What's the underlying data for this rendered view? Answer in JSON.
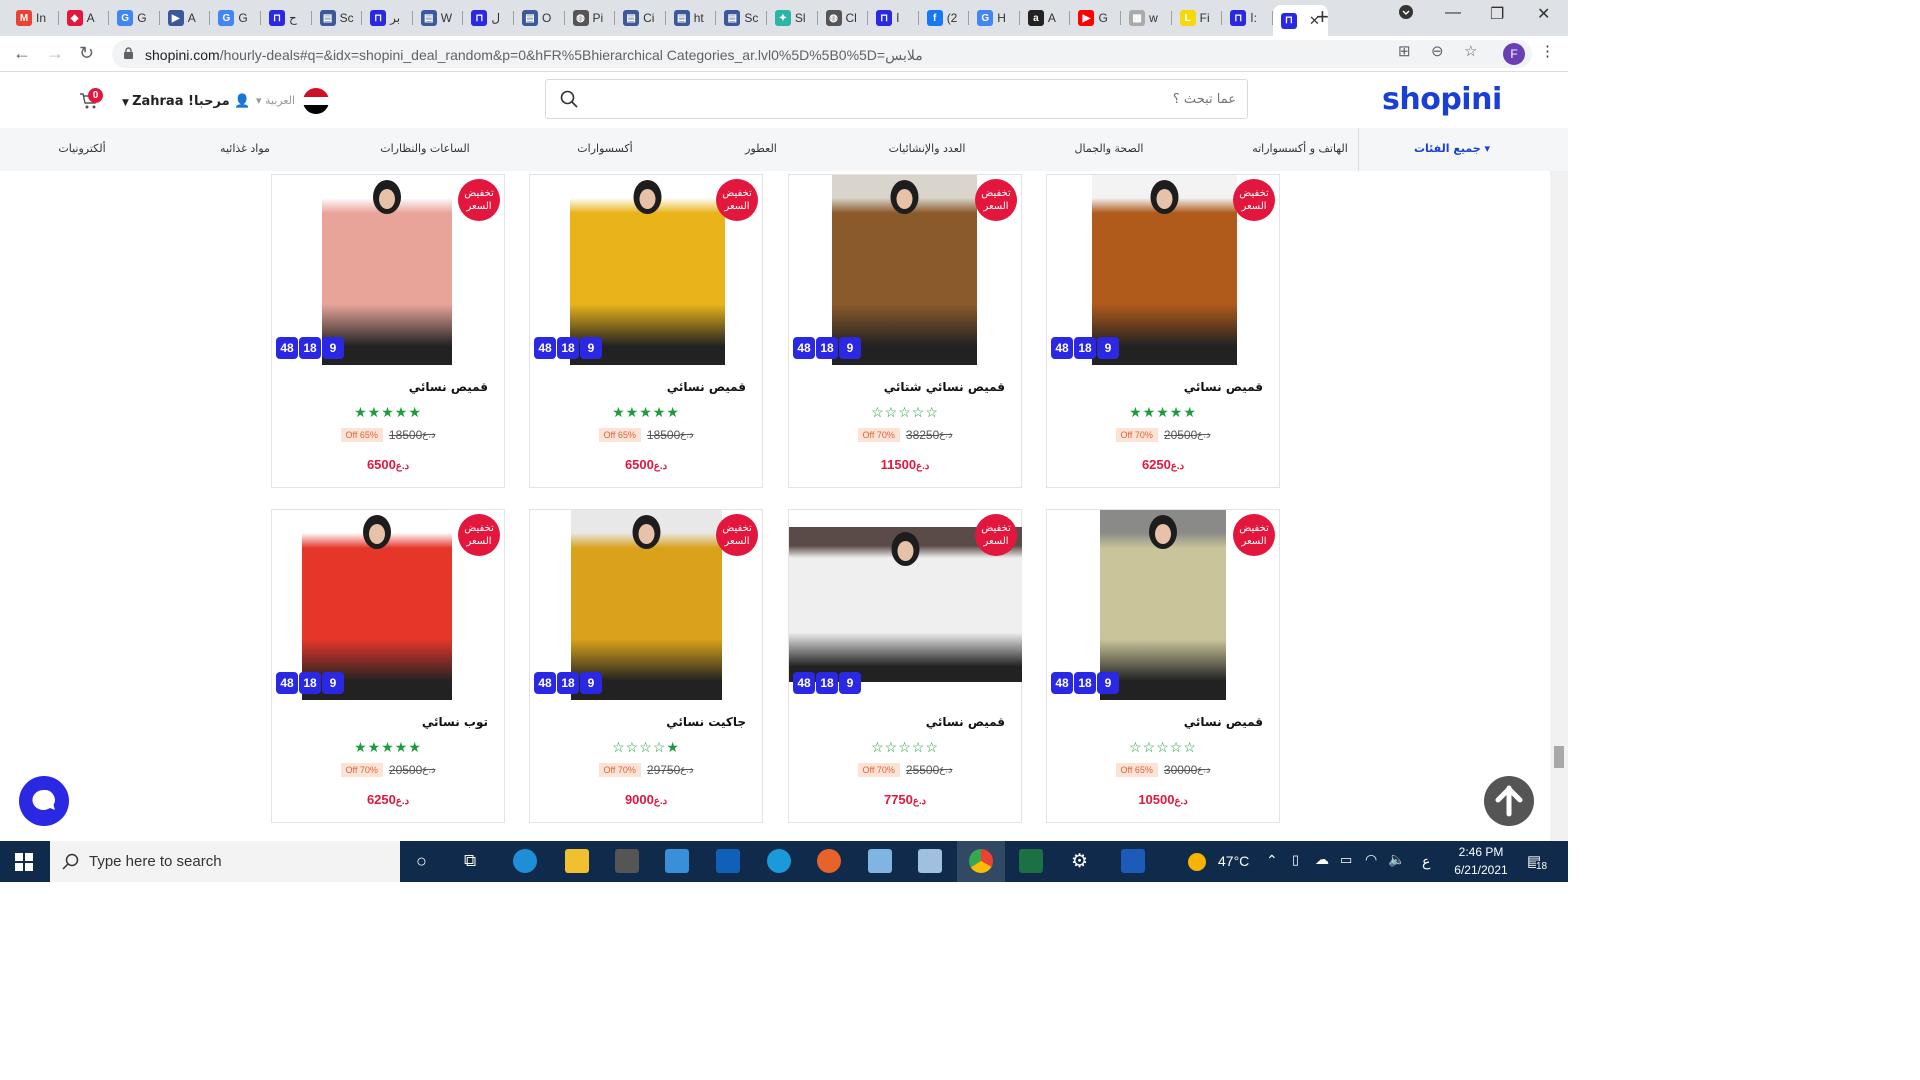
{
  "browser": {
    "tabs": [
      {
        "label": "In",
        "icon": "gmail-icon",
        "color": "#ea4335",
        "glyph": "M"
      },
      {
        "label": "A",
        "icon": "app-icon",
        "color": "#e3173e",
        "glyph": "◆"
      },
      {
        "label": "G",
        "icon": "google-translate-icon",
        "color": "#4285f4",
        "glyph": "G"
      },
      {
        "label": "A",
        "icon": "send-icon",
        "color": "#3b5998",
        "glyph": "▶"
      },
      {
        "label": "G",
        "icon": "google-translate-icon",
        "color": "#4285f4",
        "glyph": "G"
      },
      {
        "label": "ح",
        "icon": "shopini-icon",
        "color": "#2b28e3",
        "glyph": "⊓"
      },
      {
        "label": "Sc",
        "icon": "doc-icon",
        "color": "#3c5a99",
        "glyph": "▤"
      },
      {
        "label": "بر",
        "icon": "shopini-icon",
        "color": "#2b28e3",
        "glyph": "⊓"
      },
      {
        "label": "W",
        "icon": "doc-icon",
        "color": "#3c5a99",
        "glyph": "▤"
      },
      {
        "label": "ل",
        "icon": "shopini-icon",
        "color": "#2b28e3",
        "glyph": "⊓"
      },
      {
        "label": "O",
        "icon": "doc-icon",
        "color": "#3c5a99",
        "glyph": "▤"
      },
      {
        "label": "Pi",
        "icon": "globe-icon",
        "color": "#555555",
        "glyph": "◍"
      },
      {
        "label": "Ci",
        "icon": "doc-icon",
        "color": "#3c5a99",
        "glyph": "▤"
      },
      {
        "label": "ht",
        "icon": "doc-icon",
        "color": "#3c5a99",
        "glyph": "▤"
      },
      {
        "label": "Sc",
        "icon": "doc-icon",
        "color": "#3c5a99",
        "glyph": "▤"
      },
      {
        "label": "Sl",
        "icon": "kite-icon",
        "color": "#2bb5a6",
        "glyph": "✦"
      },
      {
        "label": "Cl",
        "icon": "globe-icon",
        "color": "#555555",
        "glyph": "◍"
      },
      {
        "label": "ا",
        "icon": "shopini-icon",
        "color": "#2b28e3",
        "glyph": "⊓"
      },
      {
        "label": "(2",
        "icon": "facebook-icon",
        "color": "#1877f2",
        "glyph": "f"
      },
      {
        "label": "H",
        "icon": "google-icon",
        "color": "#4285f4",
        "glyph": "G"
      },
      {
        "label": "A",
        "icon": "amazon-icon",
        "color": "#222222",
        "glyph": "a"
      },
      {
        "label": "G",
        "icon": "youtube-icon",
        "color": "#ff0000",
        "glyph": "▶"
      },
      {
        "label": "w",
        "icon": "image-icon",
        "color": "#aaaaaa",
        "glyph": "▦"
      },
      {
        "label": "Fi",
        "icon": "l-icon",
        "color": "#f5d90a",
        "glyph": "L"
      },
      {
        "label": "ا:",
        "icon": "shopini-icon",
        "color": "#2b28e3",
        "glyph": "⊓"
      },
      {
        "label": "",
        "icon": "shopini-icon",
        "color": "#2b28e3",
        "glyph": "⊓",
        "active": true
      }
    ],
    "close_glyph": "✕",
    "new_tab_glyph": "+",
    "url_host": "shopini.com",
    "url_rest": "/hourly-deals#q=&idx=shopini_deal_random&p=0&hFR%5Bhierarchical Categories_ar.lvl0%5D%5B0%5D=ملابس",
    "profile_initial": "F"
  },
  "header": {
    "logo": "shopini",
    "search_placeholder": "عما تبحث ؟",
    "language": "العربية",
    "user_greeting": "Zahraa !مرحبا",
    "cart_count": "0"
  },
  "nav": {
    "all_categories": "جميع الفئات ▾",
    "categories": [
      {
        "label": "الهاتف و أكسسواراته"
      },
      {
        "label": "الصحة والجمال"
      },
      {
        "label": "العدد والإنشائيات"
      },
      {
        "label": "العطور"
      },
      {
        "label": "أكسسوارات"
      },
      {
        "label": "الساعات والنظارات"
      },
      {
        "label": "مواد غذائيه"
      },
      {
        "label": "ألكترونيات"
      }
    ]
  },
  "sale_badge": "تخفيض السعر",
  "timer": [
    "48",
    "18",
    "9"
  ],
  "currency_old": "د.ع",
  "currency_new": "د.ع",
  "products": [
    {
      "name": "قميص نسائي",
      "rating": 5,
      "discount": "Off 70%",
      "old_price": "20500",
      "price": "6250",
      "bg": "#b05a1c",
      "bg2": "#f3f3f3"
    },
    {
      "name": "قميص نسائي شتائي",
      "rating": 0,
      "discount": "Off 70%",
      "old_price": "38250",
      "price": "11500",
      "bg": "#8a5a2a",
      "bg2": "#d9d4cc"
    },
    {
      "name": "قميص نسائي",
      "rating": 5,
      "discount": "Off 65%",
      "old_price": "18500",
      "price": "6500",
      "bg": "#e8b41a",
      "bg2": "#ffffff"
    },
    {
      "name": "قميص نسائي",
      "rating": 5,
      "discount": "Off 65%",
      "old_price": "18500",
      "price": "6500",
      "bg": "#e9a49a",
      "bg2": "#ffffff"
    },
    {
      "name": "قميص نسائي",
      "rating": 0,
      "discount": "Off 65%",
      "old_price": "30000",
      "price": "10500",
      "bg": "#c9c49a",
      "bg2": "#8a8a88"
    },
    {
      "name": "قميص نسائي",
      "rating": 0,
      "discount": "Off 70%",
      "old_price": "25500",
      "price": "7750",
      "bg": "#efefef",
      "bg2": "#5a4a48"
    },
    {
      "name": "جاكيت نسائي",
      "rating": 1,
      "discount": "Off 70%",
      "old_price": "29750",
      "price": "9000",
      "bg": "#d9a21a",
      "bg2": "#e8e8e8"
    },
    {
      "name": "توب نسائي",
      "rating": 5,
      "discount": "Off 70%",
      "old_price": "20500",
      "price": "6250",
      "bg": "#e6362a",
      "bg2": "#ffffff"
    }
  ],
  "taskbar": {
    "search_text": "Type here to search",
    "weather": "47°C",
    "lang": "ع",
    "time": "2:46 PM",
    "date": "6/21/2021",
    "notifications": "18"
  }
}
